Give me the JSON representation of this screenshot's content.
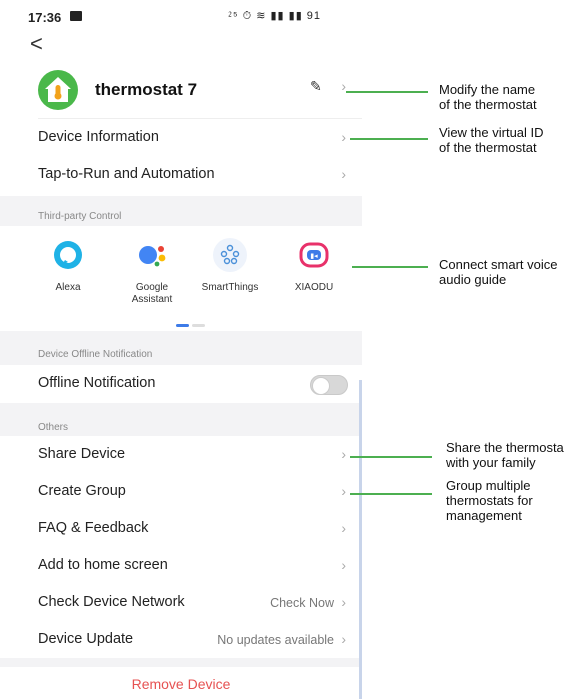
{
  "status_bar": {
    "time": "17:36",
    "icons": "⁲⁵ ⏱ ≋ ▮▮ ▮▮ 91"
  },
  "header": {
    "back_symbol": "<"
  },
  "device": {
    "name": "thermostat 7"
  },
  "rows": {
    "device_information": "Device Information",
    "tap_to_run": "Tap-to-Run and Automation",
    "offline_notification": "Offline Notification",
    "share_device": "Share Device",
    "create_group": "Create Group",
    "faq": "FAQ & Feedback",
    "add_home": "Add to home screen",
    "check_network": "Check Device Network",
    "check_network_value": "Check Now",
    "device_update": "Device Update",
    "device_update_value": "No updates available"
  },
  "sections": {
    "third_party": "Third-party Control",
    "offline": "Device Offline Notification",
    "others": "Others"
  },
  "third_party": [
    {
      "label": "Alexa",
      "color": "#1fb2e6"
    },
    {
      "label": "Google\nAssistant",
      "color": "#4285f4"
    },
    {
      "label": "SmartThings",
      "color": "#4a90d9"
    },
    {
      "label": "XIAODU",
      "color": "#e8316a"
    }
  ],
  "offline_toggle": {
    "on": false
  },
  "remove_label": "Remove Device",
  "annotations": {
    "name": "Modify the name\nof the thermostat",
    "virtual_id": "View the virtual ID\n of the thermostat",
    "voice": "Connect smart voice\n audio guide",
    "share": "Share the thermosta\nwith your family",
    "group": "Group multiple\nthermostats for\nmanagement"
  },
  "colors": {
    "accent": "#4caf50",
    "danger": "#e65252",
    "link": "#3d7be8"
  }
}
